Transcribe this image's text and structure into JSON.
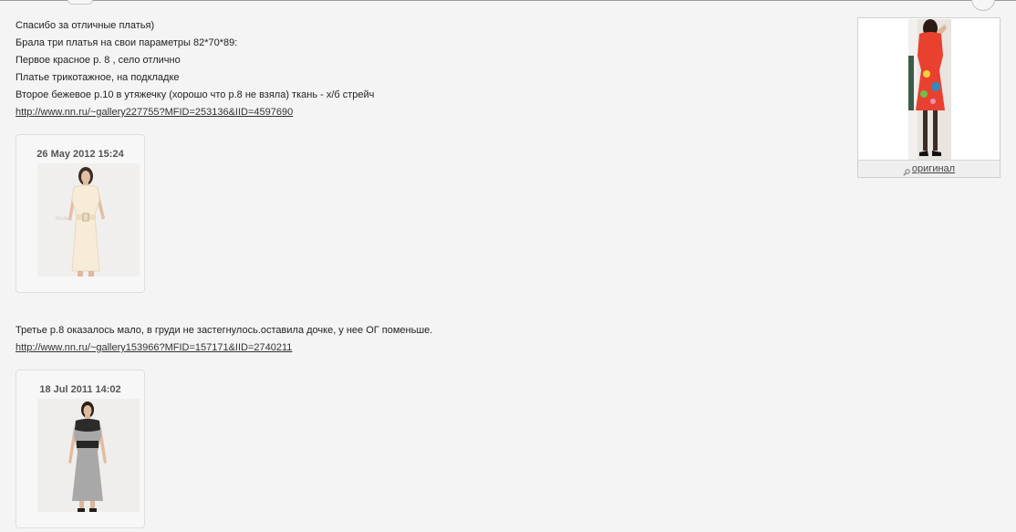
{
  "post1": {
    "lines": [
      "Спасибо за отличные платья)",
      "Брала три платья на свои параметры 82*70*89:",
      "Первое красное р. 8 , село отлично",
      "Платье трикотажное, на подкладке",
      "Второе бежевое р.10 в утяжечку (хорошо что р.8 не взяла) ткань - х/б стрейч"
    ],
    "link": "http://www.nn.ru/~gallery227755?MFID=253136&IID=4597690",
    "thumb": {
      "date": "26 May 2012 15:24"
    }
  },
  "post2": {
    "text": "Третье р.8 оказалось мало, в груди не застегнулось.оставила дочке, у нее ОГ поменьше.",
    "link": "http://www.nn.ru/~gallery153966?MFID=157171&IID=2740211",
    "thumb": {
      "date": "18 Jul 2011 14:02"
    }
  },
  "side_image": {
    "caption": "оригинал"
  }
}
